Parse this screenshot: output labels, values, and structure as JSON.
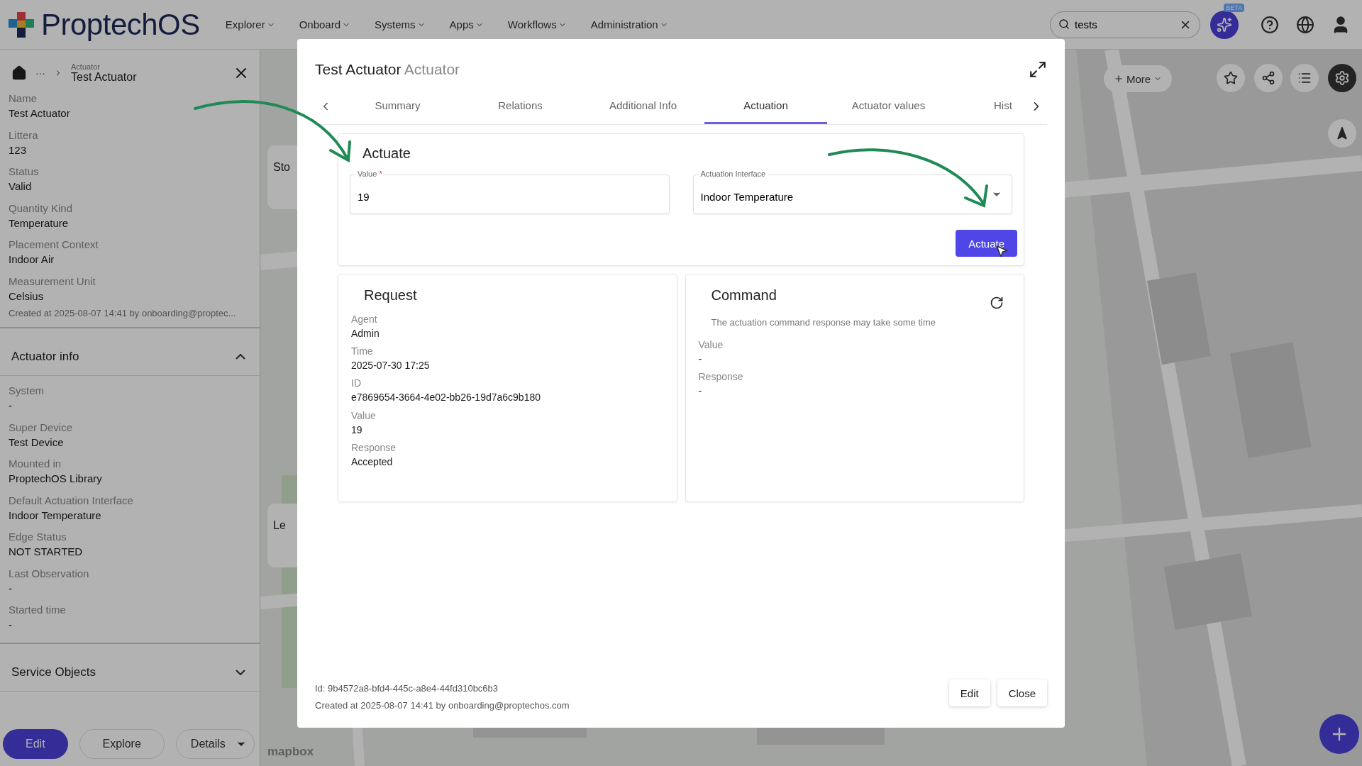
{
  "topbar": {
    "logo": "ProptechOS",
    "nav": [
      {
        "label": "Explorer"
      },
      {
        "label": "Onboard"
      },
      {
        "label": "Systems"
      },
      {
        "label": "Apps"
      },
      {
        "label": "Workflows"
      },
      {
        "label": "Administration"
      }
    ],
    "search": {
      "value": "tests"
    },
    "beta_badge": "BETA"
  },
  "side_panel": {
    "breadcrumb": {
      "ellipsis": "···",
      "type": "Actuator",
      "title": "Test Actuator"
    },
    "fields": [
      {
        "label": "Name",
        "value": "Test Actuator"
      },
      {
        "label": "Littera",
        "value": "123"
      },
      {
        "label": "Status",
        "value": "Valid"
      },
      {
        "label": "Quantity Kind",
        "value": "Temperature"
      },
      {
        "label": "Placement Context",
        "value": "Indoor Air"
      },
      {
        "label": "Measurement Unit",
        "value": "Celsius"
      }
    ],
    "created": "Created at 2025-08-07 14:41 by onboarding@proptec...",
    "sections": [
      {
        "title": "Actuator info",
        "expanded": true,
        "fields": [
          {
            "label": "System",
            "value": "-"
          },
          {
            "label": "Super Device",
            "value": "Test Device"
          },
          {
            "label": "Mounted in",
            "value": "ProptechOS Library"
          },
          {
            "label": "Default Actuation Interface",
            "value": "Indoor Temperature"
          },
          {
            "label": "Edge Status",
            "value": "NOT STARTED"
          },
          {
            "label": "Last Observation",
            "value": "-"
          },
          {
            "label": "Started time",
            "value": "-"
          }
        ]
      },
      {
        "title": "Service Objects",
        "expanded": false
      }
    ],
    "actions": [
      {
        "label": "Edit",
        "kind": "primary"
      },
      {
        "label": "Explore",
        "kind": "secondary"
      },
      {
        "label": "Details",
        "kind": "split"
      }
    ]
  },
  "map": {
    "cards": [
      "Sto",
      "Le"
    ],
    "more_button": "More",
    "attribution": "mapbox"
  },
  "modal": {
    "title": "Test Actuator",
    "subtitle": "Actuator",
    "tabs": [
      {
        "label": "Summary",
        "selected": false
      },
      {
        "label": "Relations",
        "selected": false
      },
      {
        "label": "Additional Info",
        "selected": false
      },
      {
        "label": "Actuation",
        "selected": true
      },
      {
        "label": "Actuator values",
        "selected": false
      },
      {
        "label": "Hist",
        "selected": false
      }
    ],
    "actuate": {
      "title": "Actuate",
      "value_field": {
        "label": "Value",
        "required_mark": "*",
        "value": "19"
      },
      "interface_select": {
        "label": "Actuation Interface",
        "value": "Indoor Temperature"
      },
      "button": "Actuate"
    },
    "request": {
      "title": "Request",
      "fields": [
        {
          "label": "Agent",
          "value": "Admin"
        },
        {
          "label": "Time",
          "value": "2025-07-30 17:25"
        },
        {
          "label": "ID",
          "value": "e7869654-3664-4e02-bb26-19d7a6c9b180"
        },
        {
          "label": "Value",
          "value": "19"
        },
        {
          "label": "Response",
          "value": "Accepted"
        }
      ]
    },
    "command": {
      "title": "Command",
      "note": "The actuation command response may take some time",
      "fields": [
        {
          "label": "Value",
          "value": "-"
        },
        {
          "label": "Response",
          "value": "-"
        }
      ]
    },
    "footer": {
      "id": "Id: 9b4572a8-bfd4-445c-a8e4-44fd310bc6b3",
      "created": "Created at 2025-08-07 14:41 by onboarding@proptechos.com",
      "buttons": [
        "Edit",
        "Close"
      ]
    }
  }
}
